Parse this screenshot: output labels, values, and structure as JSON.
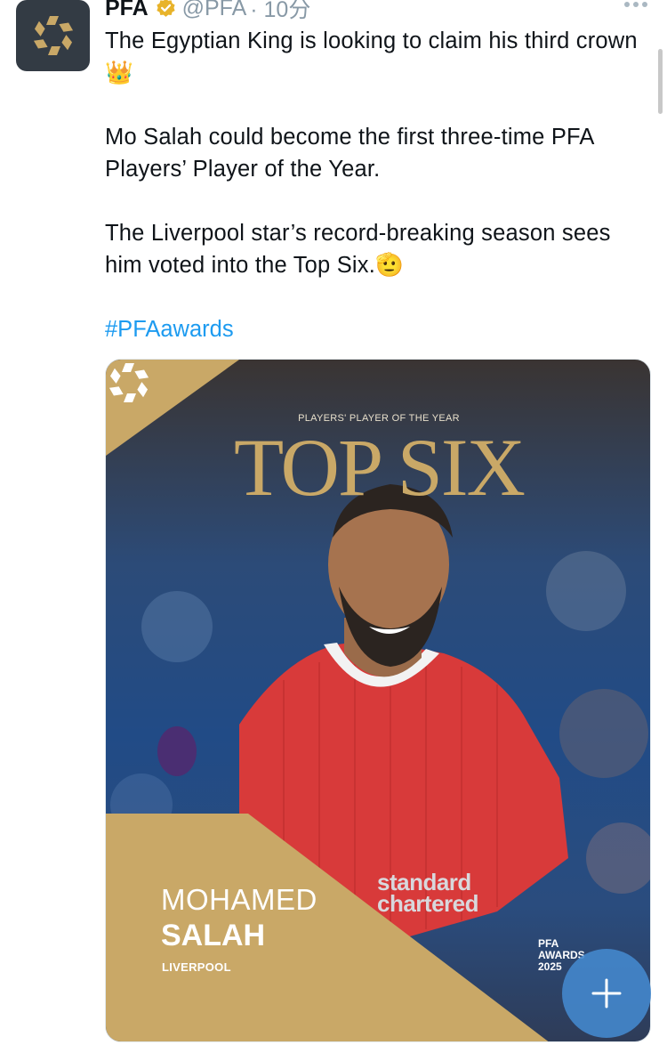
{
  "tweet": {
    "author_name": "PFA",
    "handle": "@PFA",
    "time": "· 10分",
    "paragraphs": [
      "The Egyptian King is looking to claim his third crown 👑",
      "Mo Salah could become the first three-time PFA Players’ Player of the Year.",
      "The Liverpool star’s record-breaking season sees him voted into the Top Six.🫡"
    ],
    "hashtag": "#PFAawards"
  },
  "icons": {
    "avatar": "pfa-logo-icon",
    "verified": "verified-badge-icon",
    "more": "more-options-icon",
    "compose": "plus-icon"
  },
  "media": {
    "kicker": "PLAYERS' PLAYER OF THE YEAR",
    "title": "TOP SIX",
    "player_first_name": "MOHAMED",
    "player_last_name": "SALAH",
    "club": "LIVERPOOL",
    "sponsor": "standard chartered",
    "awards_badge": [
      "PFA",
      "AWARDS",
      "2025"
    ]
  },
  "colors": {
    "gold": "#c9a867",
    "link": "#1d9bf0",
    "fab": "#4487cc",
    "verified": "#e8b32a"
  }
}
